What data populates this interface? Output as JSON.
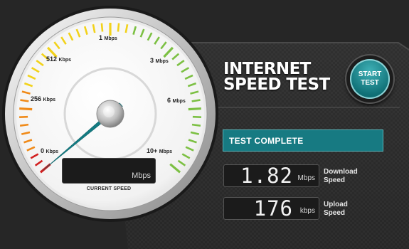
{
  "app": {
    "title_line1": "INTERNET",
    "title_line2": "SPEED TEST",
    "start_button_label": "START TEST"
  },
  "gauge": {
    "scale_labels": [
      {
        "value": "1",
        "unit": "Mbps"
      },
      {
        "value": "512",
        "unit": "Kbps"
      },
      {
        "value": "3",
        "unit": "Mbps"
      },
      {
        "value": "256",
        "unit": "Kbps"
      },
      {
        "value": "6",
        "unit": "Mbps"
      },
      {
        "value": "0",
        "unit": "Kbps"
      },
      {
        "value": "10+",
        "unit": "Mbps"
      }
    ],
    "needle_level": 0.0,
    "current_speed_value": "",
    "current_speed_unit": "Mbps",
    "current_speed_label": "CURRENT SPEED"
  },
  "status": {
    "text": "TEST COMPLETE"
  },
  "results": {
    "download": {
      "value": "1.82",
      "unit": "Mbps",
      "label_line1": "Download",
      "label_line2": "Speed"
    },
    "upload": {
      "value": "176",
      "unit": "kbps",
      "label_line1": "Upload",
      "label_line2": "Speed"
    }
  },
  "colors": {
    "accent": "#177a82",
    "tick_red": "#d22020",
    "tick_orange": "#f08a18",
    "tick_yellow": "#f2d21a",
    "tick_green": "#7cc043"
  }
}
